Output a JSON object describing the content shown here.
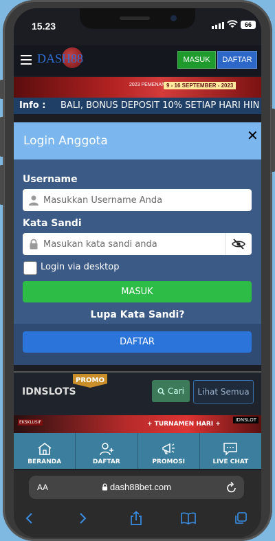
{
  "status": {
    "time": "15.23",
    "battery": "66"
  },
  "header": {
    "logo": "DASH88",
    "masuk": "MASUK",
    "daftar": "DAFTAR"
  },
  "banner": {
    "pemenang": "2023 PEMENANG",
    "dates": "9 - 16 SEPTEMBER - 2023"
  },
  "info": {
    "label": "Info :",
    "text": "BALI, BONUS DEPOSIT 10% SETIAP HARI HIN"
  },
  "modal": {
    "title": "Login Anggota",
    "close": "✕",
    "username_label": "Username",
    "username_placeholder": "Masukkan Username Anda",
    "password_label": "Kata Sandi",
    "password_placeholder": "Masukan kata sandi anda",
    "desktop_label": "Login via desktop",
    "masuk_button": "MASUK",
    "forgot": "Lupa Kata Sandi?",
    "daftar_button": "DAFTAR"
  },
  "section": {
    "title": "IDNSLOTS",
    "promo": "PROMO",
    "cari": "Cari",
    "lihat": "Lihat Semua"
  },
  "game": {
    "eksklusif": "EKSKLUSIF",
    "turnamen": "+ TURNAMEN HARI +",
    "brand": "IDNSLOT"
  },
  "bottom_nav": [
    {
      "label": "BERANDA",
      "icon": "home-icon"
    },
    {
      "label": "DAFTAR",
      "icon": "add-user-icon"
    },
    {
      "label": "PROMOSI",
      "icon": "megaphone-icon"
    },
    {
      "label": "LIVE CHAT",
      "icon": "chat-icon"
    }
  ],
  "browser": {
    "aa": "AA",
    "url": "dash88bet.com"
  }
}
